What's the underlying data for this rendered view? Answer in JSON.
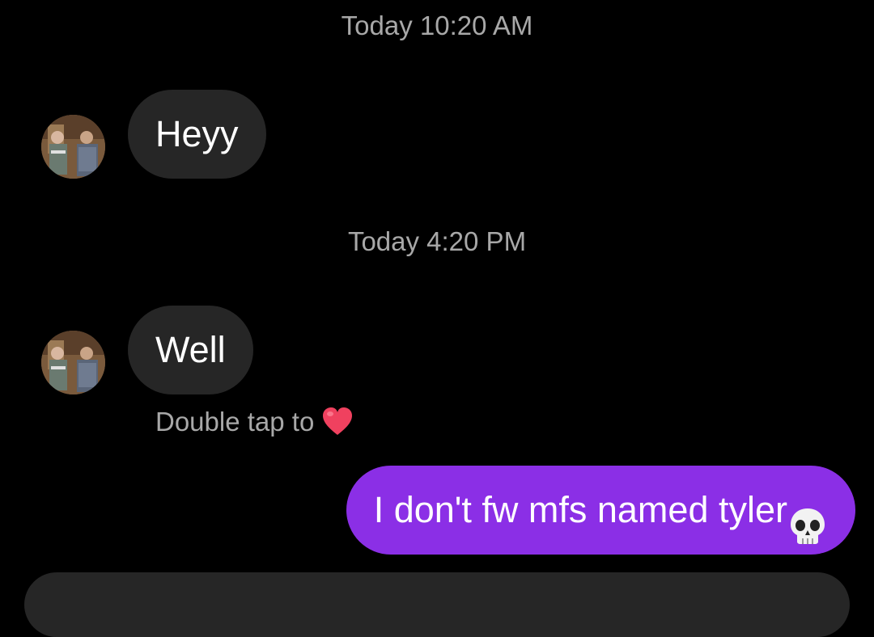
{
  "timestamps": [
    "Today 10:20 AM",
    "Today 4:20 PM"
  ],
  "messages": {
    "incoming": [
      {
        "text": "Heyy"
      },
      {
        "text": "Well"
      }
    ],
    "outgoing": [
      {
        "text": "I don't fw mfs named tyler"
      }
    ]
  },
  "hint": {
    "text": "Double tap to",
    "icon": "heart-icon"
  },
  "colors": {
    "background": "#000000",
    "incoming_bubble": "#262626",
    "outgoing_bubble": "#8b2fe6",
    "timestamp": "#a8a8a8"
  },
  "icons": {
    "reaction": "skull-icon"
  }
}
